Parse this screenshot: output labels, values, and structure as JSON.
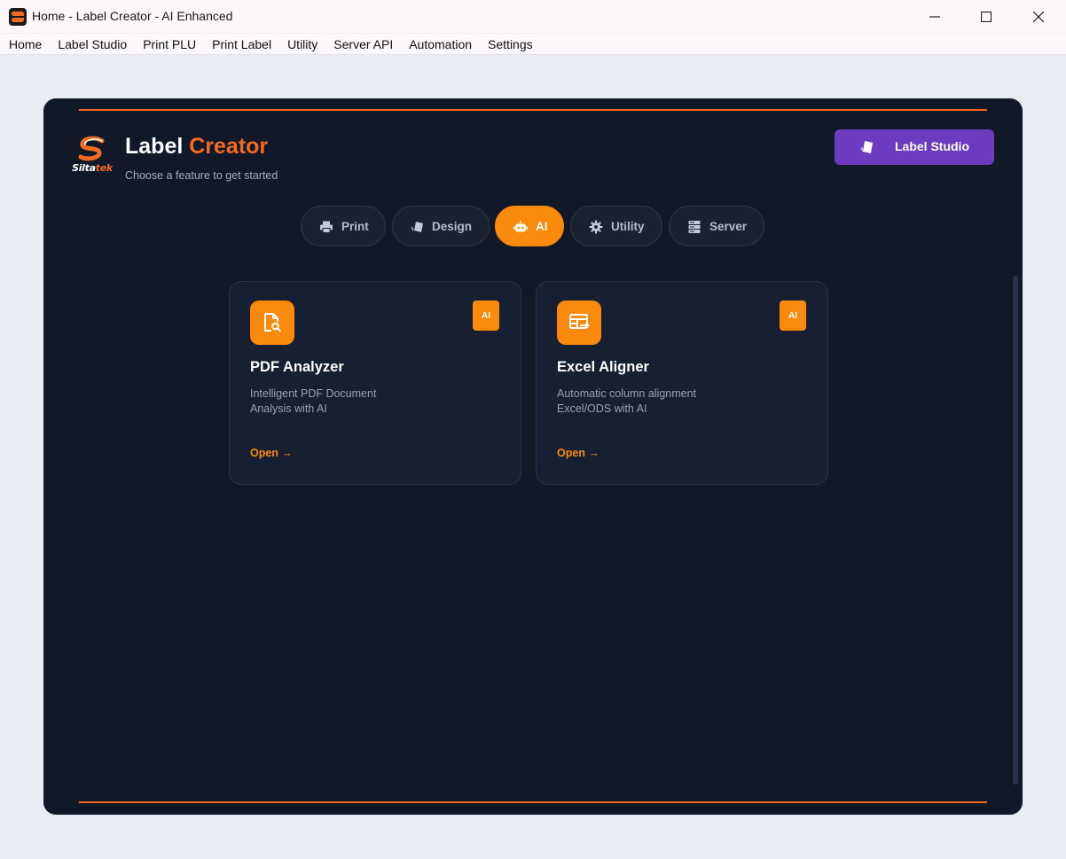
{
  "window": {
    "title": "Home - Label Creator - AI Enhanced",
    "controls": [
      "minimize-icon",
      "maximize-icon",
      "close-icon"
    ]
  },
  "menu": {
    "items": [
      "Home",
      "Label Studio",
      "Print PLU",
      "Print Label",
      "Utility",
      "Server API",
      "Automation",
      "Settings"
    ]
  },
  "header": {
    "logo_brand_a": "Silta",
    "logo_brand_b": "tek",
    "title_main": "Label",
    "title_accent": "Creator",
    "subtitle": "Choose a feature to get started",
    "studio_button": "Label Studio"
  },
  "tabs": [
    {
      "label": "Print",
      "icon": "printer-icon",
      "active": false
    },
    {
      "label": "Design",
      "icon": "shapes-icon",
      "active": false
    },
    {
      "label": "AI",
      "icon": "robot-icon",
      "active": true
    },
    {
      "label": "Utility",
      "icon": "gear-icon",
      "active": false
    },
    {
      "label": "Server",
      "icon": "server-icon",
      "active": false
    }
  ],
  "cards": [
    {
      "title": "PDF Analyzer",
      "badge": "AI",
      "desc_line1": "Intelligent PDF Document",
      "desc_line2": "Analysis with AI",
      "open": "Open →",
      "icon": "file-search-icon"
    },
    {
      "title": "Excel Aligner",
      "badge": "AI",
      "desc_line1": "Automatic column alignment",
      "desc_line2": "Excel/ODS with AI",
      "open": "Open →",
      "icon": "table-align-icon"
    }
  ],
  "colors": {
    "accent": "#f36b21",
    "active_tab": "#f98a0c",
    "studio_button": "#6d3bbf",
    "panel_bg": "#111827"
  }
}
